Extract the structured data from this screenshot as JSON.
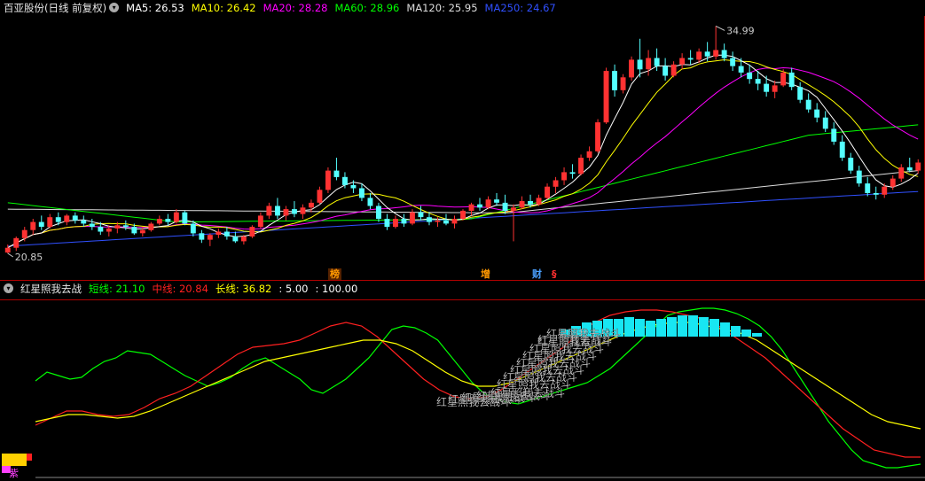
{
  "main_header": {
    "stock_title": "百亚股份(日线 前复权)",
    "ma": [
      {
        "label": "MA5: 26.53",
        "color": "#ffffff"
      },
      {
        "label": "MA10: 26.42",
        "color": "#ffff00"
      },
      {
        "label": "MA20: 28.28",
        "color": "#ff00ff"
      },
      {
        "label": "MA60: 28.96",
        "color": "#00ff00"
      },
      {
        "label": "MA120: 25.95",
        "color": "#dddddd"
      },
      {
        "label": "MA250: 24.67",
        "color": "#3050ff"
      }
    ]
  },
  "price_labels": {
    "high": "34.99",
    "low": "20.85"
  },
  "event_badges": [
    {
      "text": "榜",
      "color": "#ff9900",
      "bg": "#552200"
    },
    {
      "text": "增",
      "color": "#ff9900",
      "bg": ""
    },
    {
      "text": "财",
      "color": "#4aa0ff",
      "bg": ""
    },
    {
      "text": "§",
      "color": "#ff3030",
      "bg": ""
    }
  ],
  "sub_header": {
    "indicator_name": "红星照我去战",
    "items": [
      {
        "label": "短线: 21.10",
        "color": "#00ff00"
      },
      {
        "label": "中线: 20.84",
        "color": "#ff2020"
      },
      {
        "label": "长线: 36.82",
        "color": "#ffff00"
      },
      {
        "label": ": 5.00",
        "color": "#ffffff"
      },
      {
        "label": ": 100.00",
        "color": "#ffffff"
      }
    ]
  },
  "signal_text": "红星照我去战斗",
  "corner_mark": "紫",
  "chart_data": {
    "type": "candlestick",
    "symbol": "百亚股份",
    "period": "日线 前复权",
    "ohlc": [
      [
        20.9,
        21.4,
        20.85,
        21.2
      ],
      [
        21.2,
        21.9,
        21.0,
        21.8
      ],
      [
        21.8,
        22.5,
        21.6,
        22.3
      ],
      [
        22.3,
        23.0,
        22.0,
        22.8
      ],
      [
        22.8,
        23.2,
        22.3,
        22.5
      ],
      [
        22.5,
        23.3,
        22.4,
        23.1
      ],
      [
        23.1,
        23.4,
        22.6,
        22.8
      ],
      [
        22.8,
        23.3,
        22.6,
        23.2
      ],
      [
        23.2,
        23.4,
        22.7,
        22.9
      ],
      [
        22.9,
        23.2,
        22.5,
        22.7
      ],
      [
        22.7,
        23.0,
        22.3,
        22.5
      ],
      [
        22.5,
        22.8,
        22.0,
        22.2
      ],
      [
        22.2,
        22.6,
        21.9,
        22.4
      ],
      [
        22.4,
        22.8,
        22.1,
        22.6
      ],
      [
        22.6,
        22.9,
        22.3,
        22.5
      ],
      [
        22.5,
        22.7,
        22.0,
        22.1
      ],
      [
        22.1,
        22.5,
        21.9,
        22.3
      ],
      [
        22.3,
        22.8,
        22.2,
        22.7
      ],
      [
        22.7,
        23.2,
        22.6,
        23.0
      ],
      [
        23.0,
        23.3,
        22.6,
        22.8
      ],
      [
        22.8,
        23.6,
        22.7,
        23.4
      ],
      [
        23.4,
        23.5,
        22.6,
        22.7
      ],
      [
        22.7,
        22.9,
        21.9,
        22.1
      ],
      [
        22.1,
        22.3,
        21.5,
        21.7
      ],
      [
        21.7,
        22.1,
        21.3,
        22.0
      ],
      [
        22.0,
        22.4,
        21.8,
        22.2
      ],
      [
        22.2,
        22.5,
        21.7,
        21.9
      ],
      [
        21.9,
        22.2,
        21.5,
        21.6
      ],
      [
        21.6,
        22.0,
        21.4,
        21.9
      ],
      [
        21.9,
        22.6,
        21.8,
        22.5
      ],
      [
        22.5,
        23.4,
        22.4,
        23.2
      ],
      [
        23.2,
        24.0,
        23.0,
        23.8
      ],
      [
        23.8,
        24.3,
        23.0,
        23.2
      ],
      [
        23.2,
        23.8,
        22.9,
        23.6
      ],
      [
        23.6,
        24.1,
        23.1,
        23.3
      ],
      [
        23.3,
        23.9,
        23.0,
        23.7
      ],
      [
        23.7,
        24.2,
        23.4,
        24.0
      ],
      [
        24.0,
        25.0,
        23.9,
        24.8
      ],
      [
        24.8,
        26.2,
        24.6,
        26.0
      ],
      [
        26.0,
        26.8,
        25.4,
        25.6
      ],
      [
        25.6,
        25.9,
        24.9,
        25.1
      ],
      [
        25.1,
        25.4,
        24.6,
        24.9
      ],
      [
        24.9,
        25.2,
        24.1,
        24.3
      ],
      [
        24.3,
        24.6,
        23.6,
        23.8
      ],
      [
        23.8,
        24.0,
        22.8,
        23.0
      ],
      [
        23.0,
        23.3,
        22.3,
        22.5
      ],
      [
        22.5,
        23.2,
        22.4,
        23.0
      ],
      [
        23.0,
        23.3,
        22.5,
        22.7
      ],
      [
        22.7,
        23.6,
        22.6,
        23.4
      ],
      [
        23.4,
        23.8,
        22.9,
        23.1
      ],
      [
        23.1,
        23.4,
        22.6,
        22.8
      ],
      [
        22.8,
        23.1,
        22.5,
        22.9
      ],
      [
        22.9,
        23.3,
        22.6,
        22.7
      ],
      [
        22.7,
        23.2,
        22.4,
        23.0
      ],
      [
        23.0,
        23.6,
        22.9,
        23.5
      ],
      [
        23.5,
        24.0,
        23.2,
        23.9
      ],
      [
        23.9,
        24.3,
        23.5,
        23.7
      ],
      [
        23.7,
        24.4,
        23.6,
        24.2
      ],
      [
        24.2,
        24.6,
        23.8,
        24.0
      ],
      [
        24.0,
        24.5,
        23.3,
        23.5
      ],
      [
        23.5,
        23.9,
        21.6,
        23.7
      ],
      [
        23.7,
        24.4,
        23.6,
        24.1
      ],
      [
        24.1,
        24.5,
        23.7,
        23.9
      ],
      [
        23.9,
        24.5,
        23.8,
        24.3
      ],
      [
        24.3,
        25.2,
        24.2,
        25.0
      ],
      [
        25.0,
        25.6,
        24.6,
        25.4
      ],
      [
        25.4,
        26.2,
        25.1,
        25.9
      ],
      [
        25.9,
        26.4,
        25.5,
        25.8
      ],
      [
        25.8,
        27.0,
        25.7,
        26.8
      ],
      [
        26.8,
        27.5,
        26.6,
        27.2
      ],
      [
        27.2,
        29.2,
        27.1,
        29.0
      ],
      [
        29.0,
        32.4,
        28.9,
        32.2
      ],
      [
        32.2,
        32.6,
        30.6,
        31.0
      ],
      [
        31.0,
        32.0,
        30.8,
        31.8
      ],
      [
        31.8,
        33.1,
        31.6,
        32.9
      ],
      [
        32.9,
        34.2,
        31.8,
        32.3
      ],
      [
        32.3,
        33.5,
        31.9,
        33.0
      ],
      [
        33.0,
        33.6,
        32.2,
        32.5
      ],
      [
        32.5,
        33.0,
        31.6,
        31.9
      ],
      [
        31.9,
        32.8,
        31.8,
        32.6
      ],
      [
        32.6,
        33.3,
        32.3,
        33.0
      ],
      [
        33.0,
        33.5,
        32.6,
        32.9
      ],
      [
        32.9,
        33.6,
        32.7,
        33.4
      ],
      [
        33.4,
        34.0,
        32.8,
        33.1
      ],
      [
        33.1,
        34.99,
        32.9,
        33.5
      ],
      [
        33.5,
        33.9,
        32.8,
        33.0
      ],
      [
        33.0,
        33.4,
        32.2,
        32.5
      ],
      [
        32.5,
        33.0,
        31.8,
        32.1
      ],
      [
        32.1,
        32.6,
        31.4,
        31.7
      ],
      [
        31.7,
        32.2,
        31.0,
        31.4
      ],
      [
        31.4,
        31.9,
        30.6,
        30.9
      ],
      [
        30.9,
        31.6,
        30.5,
        31.3
      ],
      [
        31.3,
        32.3,
        31.2,
        32.1
      ],
      [
        32.1,
        32.4,
        31.0,
        31.2
      ],
      [
        31.2,
        31.5,
        30.2,
        30.4
      ],
      [
        30.4,
        30.8,
        29.6,
        29.8
      ],
      [
        29.8,
        30.2,
        29.0,
        29.3
      ],
      [
        29.3,
        29.7,
        28.4,
        28.6
      ],
      [
        28.6,
        29.0,
        27.6,
        27.8
      ],
      [
        27.8,
        28.2,
        26.6,
        26.8
      ],
      [
        26.8,
        27.1,
        25.8,
        26.0
      ],
      [
        26.0,
        26.3,
        25.0,
        25.2
      ],
      [
        25.2,
        25.6,
        24.4,
        24.6
      ],
      [
        24.6,
        25.0,
        24.2,
        24.5
      ],
      [
        24.5,
        25.2,
        24.3,
        25.0
      ],
      [
        25.0,
        25.7,
        24.8,
        25.5
      ],
      [
        25.5,
        26.4,
        25.3,
        26.2
      ],
      [
        26.2,
        26.8,
        25.9,
        26.0
      ],
      [
        26.0,
        26.7,
        25.8,
        26.5
      ]
    ],
    "ma_lines": [
      {
        "name": "MA5",
        "color": "#ffffff",
        "value": 26.53
      },
      {
        "name": "MA10",
        "color": "#ffff00",
        "value": 26.42
      },
      {
        "name": "MA20",
        "color": "#ff00ff",
        "value": 28.28
      },
      {
        "name": "MA60",
        "color": "#00ff00",
        "value": 28.96
      },
      {
        "name": "MA120",
        "color": "#dddddd",
        "value": 25.95
      },
      {
        "name": "MA250",
        "color": "#3050ff",
        "value": 24.67
      }
    ],
    "price_high": 34.99,
    "price_low": 20.85,
    "indicator": {
      "name": "红星照我去战",
      "ylim": [
        0,
        100
      ],
      "short_line": [
        55,
        60,
        58,
        56,
        57,
        62,
        66,
        68,
        72,
        71,
        70,
        66,
        62,
        58,
        55,
        52,
        54,
        57,
        62,
        66,
        68,
        64,
        60,
        56,
        50,
        48,
        52,
        56,
        62,
        68,
        76,
        84,
        86,
        85,
        82,
        78,
        70,
        62,
        54,
        48,
        45,
        43,
        42,
        44,
        46,
        48,
        50,
        52,
        54,
        58,
        62,
        68,
        74,
        80,
        86,
        92,
        94,
        95,
        96,
        96,
        95,
        93,
        90,
        86,
        80,
        72,
        62,
        52,
        42,
        32,
        24,
        16,
        10,
        8,
        6,
        6,
        7,
        8
      ],
      "mid_line": [
        30,
        34,
        38,
        38,
        36,
        35,
        36,
        40,
        45,
        48,
        52,
        58,
        64,
        70,
        74,
        75,
        76,
        78,
        82,
        86,
        88,
        86,
        80,
        72,
        64,
        56,
        50,
        46,
        45,
        46,
        50,
        56,
        62,
        68,
        74,
        82,
        88,
        92,
        94,
        95,
        95,
        94,
        92,
        90,
        86,
        80,
        74,
        68,
        60,
        52,
        44,
        36,
        28,
        22,
        16,
        14,
        12,
        12
      ],
      "long_line": [
        32,
        34,
        36,
        36,
        35,
        34,
        35,
        38,
        42,
        46,
        50,
        54,
        58,
        62,
        66,
        68,
        70,
        72,
        74,
        76,
        78,
        78,
        76,
        72,
        66,
        60,
        55,
        52,
        52,
        54,
        58,
        62,
        66,
        70,
        74,
        78,
        82,
        85,
        87,
        88,
        88,
        86,
        84,
        82,
        78,
        72,
        66,
        60,
        54,
        48,
        42,
        36,
        32,
        30,
        28
      ]
    }
  }
}
